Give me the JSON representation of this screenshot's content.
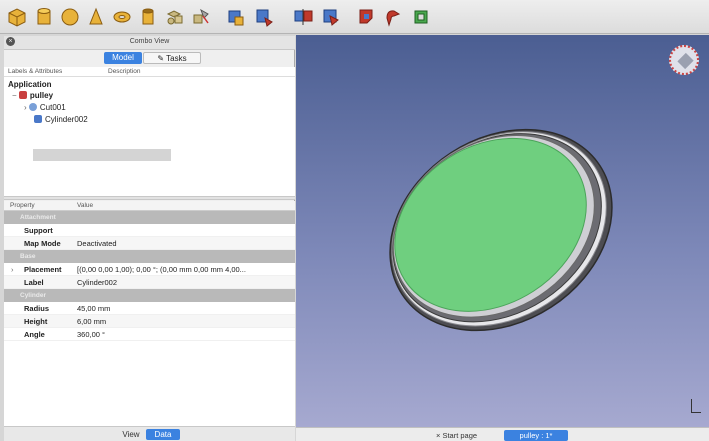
{
  "toolbar": {
    "icons": [
      "cube-icon",
      "cylinder-icon",
      "sphere-icon",
      "cone-icon",
      "torus-icon",
      "tube-icon",
      "primitives-icon",
      "shape-builder-icon",
      "extrude-icon",
      "revolve-icon",
      "mirror-icon",
      "fillet-icon",
      "chamfer-icon",
      "make-face-icon"
    ]
  },
  "combo": {
    "title": "Combo View",
    "tabs": {
      "model": "Model",
      "tasks": "Tasks"
    },
    "tree_header": {
      "labels": "Labels & Attributes",
      "description": "Description"
    },
    "application": "Application",
    "items": [
      {
        "label": "pulley"
      },
      {
        "label": "Cut001"
      },
      {
        "label": "Cylinder002"
      }
    ]
  },
  "props": {
    "header": {
      "property": "Property",
      "value": "Value"
    },
    "groups": {
      "attachment": "Attachment",
      "base": "Base",
      "cylinder": "Cylinder"
    },
    "rows": {
      "support": {
        "name": "Support",
        "value": ""
      },
      "map_mode": {
        "name": "Map Mode",
        "value": "Deactivated"
      },
      "placement": {
        "name": "Placement",
        "value": "[(0,00 0,00 1,00); 0,00 °; (0,00 mm  0,00 mm  4,00..."
      },
      "label": {
        "name": "Label",
        "value": "Cylinder002"
      },
      "radius": {
        "name": "Radius",
        "value": "45,00 mm"
      },
      "height": {
        "name": "Height",
        "value": "6,00 mm"
      },
      "angle": {
        "name": "Angle",
        "value": "360,00 °"
      }
    }
  },
  "bottom_tabs": {
    "view": "View",
    "data": "Data"
  },
  "doc_tabs": {
    "start": "Start page",
    "pulley": "pulley : 1*"
  },
  "colors": {
    "accent": "#3b82e0",
    "face_green": "#6fcf7f",
    "background_top": "#4b5e92"
  }
}
